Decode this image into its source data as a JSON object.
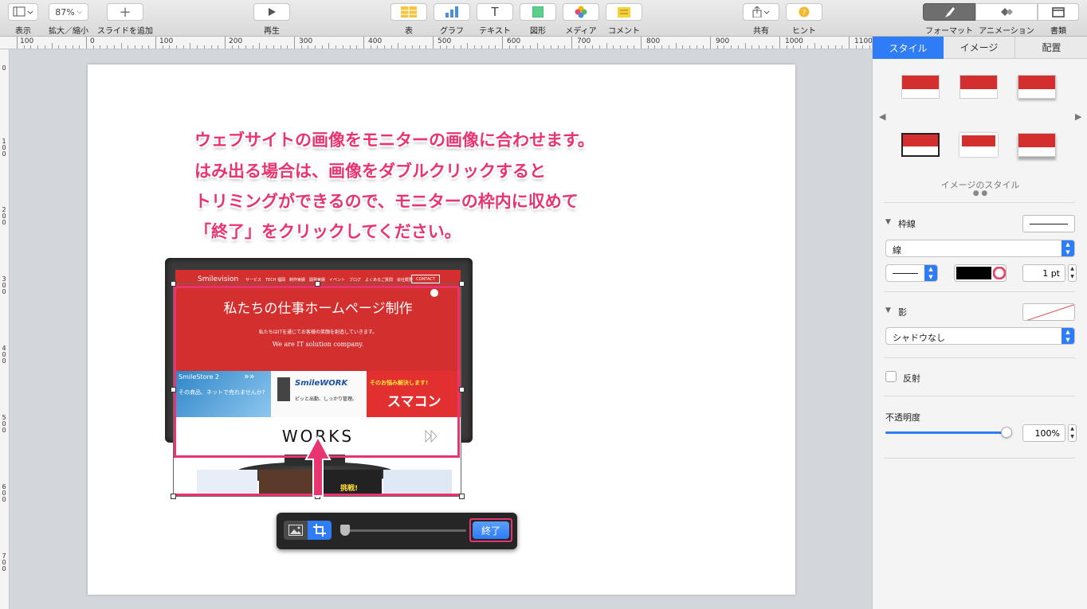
{
  "toolbar": {
    "view_label": "表示",
    "zoom_value": "87%",
    "zoom_label": "拡大／縮小",
    "add_slide_label": "スライドを追加",
    "play_label": "再生",
    "table_label": "表",
    "chart_label": "グラフ",
    "text_label": "テキスト",
    "shape_label": "図形",
    "media_label": "メディア",
    "comment_label": "コメント",
    "share_label": "共有",
    "tips_label": "ヒント",
    "format_label": "フォーマット",
    "animate_label": "アニメーション",
    "document_label": "書類"
  },
  "ruler": {
    "h_ticks": [
      "100",
      "0",
      "100",
      "200",
      "300",
      "400",
      "500",
      "600",
      "700",
      "800",
      "900",
      "1000",
      "1100"
    ],
    "v_ticks": [
      "0",
      "100",
      "200",
      "300",
      "400",
      "500",
      "600",
      "700"
    ]
  },
  "slide": {
    "instructions": [
      "ウェブサイトの画像をモニターの画像に合わせます。",
      "はみ出る場合は、画像をダブルクリックすると",
      "トリミングができるので、モニターの枠内に収めて",
      "「終了」をクリックしてください。"
    ],
    "website": {
      "logo": "Smilevision",
      "nav": "サービス　TECH 福岡　制作実績　開発実績　イベント　ブログ　よくあるご質問　会社概要",
      "contact": "CONTACT",
      "headline": "私たちの仕事ホームページ制作",
      "subline": "私たちはITを通じてお客様の笑顔を創造していきます。",
      "tagline": "We are IT solution company.",
      "banner1_title": "SmileStore 2",
      "banner1_text": "その商品、ネットで売れませんか?",
      "banner2_title": "SmileWORK",
      "banner2_text": "ピッと出勤、しっかり管理。",
      "banner3_top": "そのお悩み解決します!",
      "banner3_title": "スマコン",
      "works": "WORKS",
      "thumb_text": "挑戦!"
    }
  },
  "crop_toolbar": {
    "done_label": "終了"
  },
  "sidebar": {
    "tabs": [
      "スタイル",
      "イメージ",
      "配置"
    ],
    "image_styles_label": "イメージのスタイル",
    "border_label": "枠線",
    "border_type": "線",
    "border_width": "1 pt",
    "shadow_label": "影",
    "shadow_type": "シャドウなし",
    "reflection_label": "反射",
    "opacity_label": "不透明度",
    "opacity_value": "100%"
  },
  "colors": {
    "accent": "#2e7cf6",
    "annotation": "#e8356f",
    "hero": "#d32f2f"
  }
}
